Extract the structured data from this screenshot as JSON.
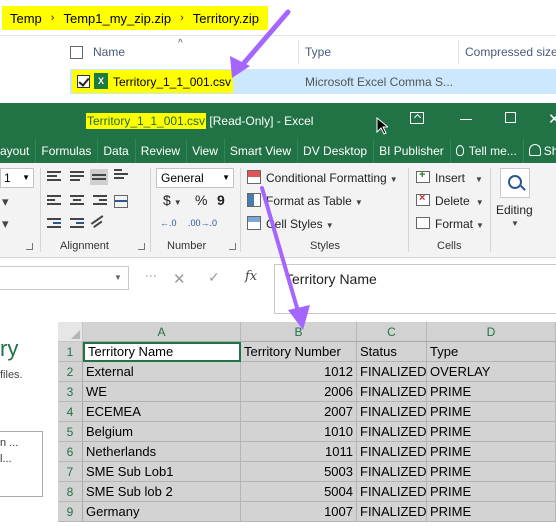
{
  "explorer": {
    "breadcrumb": [
      "Temp",
      "Temp1_my_zip.zip",
      "Territory.zip"
    ],
    "breadcrumb_separator": "›",
    "columns": {
      "name": "Name",
      "type": "Type",
      "size": "Compressed size"
    },
    "file": {
      "name": "Territory_1_1_001.csv",
      "type": "Microsoft Excel Comma S...",
      "icon": "excel-csv-icon",
      "icon_text": "X"
    },
    "highlight_color": "#ffff00",
    "selection_color": "#cce8ff"
  },
  "excel": {
    "title": {
      "filename": "Territory_1_1_001.csv",
      "suffix": " [Read-Only] - Excel"
    },
    "accent_color": "#217346",
    "tabs": [
      "ayout",
      "Formulas",
      "Data",
      "Review",
      "View",
      "Smart View",
      "DV Desktop",
      "BI Publisher",
      "Tell me...",
      "Share"
    ],
    "ribbon": {
      "font_size": "1",
      "number_format": "General",
      "currency_symbol": "$",
      "percent_symbol": "%",
      "comma_symbol": "9",
      "decimals_increase": "←.0",
      "decimals_decrease": ".00→.0",
      "styles": [
        "Conditional Formatting",
        "Format as Table",
        "Cell Styles"
      ],
      "cells": [
        "Insert",
        "Delete",
        "Format"
      ],
      "editing": "Editing",
      "group_labels": {
        "alignment": "Alignment",
        "number": "Number",
        "styles": "Styles",
        "cells": "Cells"
      }
    },
    "formula_bar": {
      "cancel": "✕",
      "enter": "✓",
      "fx": "fx",
      "value": "Territory Name"
    },
    "left_pane": {
      "heading_fragment": "ry",
      "text_fragment": "files.",
      "list_line1": "n ...",
      "list_line2": "l..."
    },
    "grid": {
      "columns": [
        "A",
        "B",
        "C",
        "D"
      ],
      "rows": [
        {
          "n": "1",
          "cells": [
            "Territory Name",
            "Territory Number",
            "Status",
            "Type"
          ]
        },
        {
          "n": "2",
          "cells": [
            "External",
            "1012",
            "FINALIZED",
            "OVERLAY"
          ]
        },
        {
          "n": "3",
          "cells": [
            "WE",
            "2006",
            "FINALIZED",
            "PRIME"
          ]
        },
        {
          "n": "4",
          "cells": [
            "ECEMEA",
            "2007",
            "FINALIZED",
            "PRIME"
          ]
        },
        {
          "n": "5",
          "cells": [
            "Belgium",
            "1010",
            "FINALIZED",
            "PRIME"
          ]
        },
        {
          "n": "6",
          "cells": [
            "Netherlands",
            "1011",
            "FINALIZED",
            "PRIME"
          ]
        },
        {
          "n": "7",
          "cells": [
            "SME Sub Lob1",
            "5003",
            "FINALIZED",
            "PRIME"
          ]
        },
        {
          "n": "8",
          "cells": [
            "SME Sub lob 2",
            "5004",
            "FINALIZED",
            "PRIME"
          ]
        },
        {
          "n": "9",
          "cells": [
            "Germany",
            "1007",
            "FINALIZED",
            "PRIME"
          ]
        }
      ]
    }
  },
  "annotations": {
    "arrow_color": "#a566ff"
  }
}
